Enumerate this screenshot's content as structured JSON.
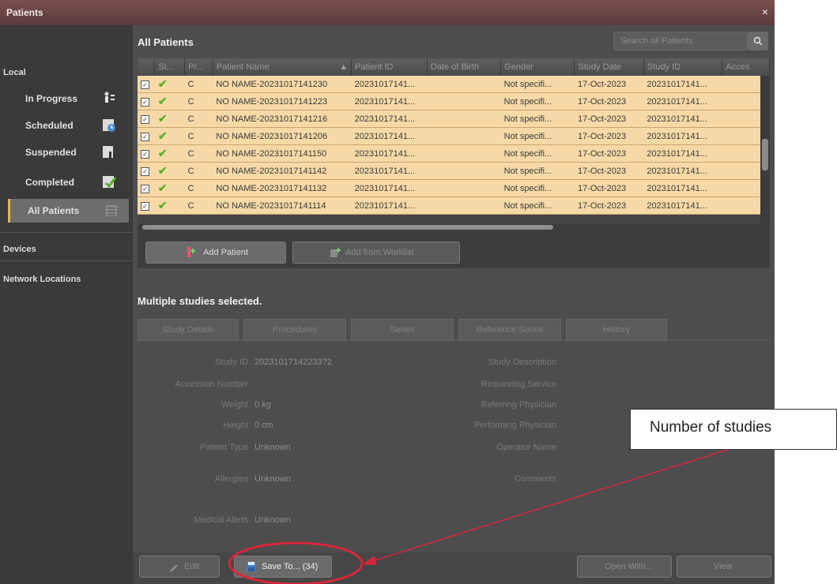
{
  "window": {
    "title": "Patients",
    "close_label": "×"
  },
  "sidebar": {
    "local_label": "Local",
    "items": [
      {
        "label": "In Progress",
        "icon": "in-progress-icon"
      },
      {
        "label": "Scheduled",
        "icon": "scheduled-icon"
      },
      {
        "label": "Suspended",
        "icon": "suspended-icon"
      },
      {
        "label": "Completed",
        "icon": "completed-icon"
      },
      {
        "label": "All Patients",
        "icon": "all-patients-icon",
        "active": true
      }
    ],
    "devices_label": "Devices",
    "network_label": "Network Locations"
  },
  "main": {
    "title": "All Patients",
    "search_placeholder": "Search all Patients",
    "search_icon": "search-icon"
  },
  "table": {
    "columns": [
      "St...",
      "Pr...",
      "Patient Name",
      "Patient ID",
      "Date of Birth",
      "Gender",
      "Study Date",
      "Study ID",
      "Acces"
    ],
    "sort_indicator": "▲",
    "rows": [
      {
        "status": "C",
        "name": "NO NAME-20231017141230",
        "pid": "20231017141...",
        "dob": "",
        "gender": "Not specifi...",
        "date": "17-Oct-2023",
        "sid": "20231017141..."
      },
      {
        "status": "C",
        "name": "NO NAME-20231017141223",
        "pid": "20231017141...",
        "dob": "",
        "gender": "Not specifi...",
        "date": "17-Oct-2023",
        "sid": "20231017141..."
      },
      {
        "status": "C",
        "name": "NO NAME-20231017141216",
        "pid": "20231017141...",
        "dob": "",
        "gender": "Not specifi...",
        "date": "17-Oct-2023",
        "sid": "20231017141..."
      },
      {
        "status": "C",
        "name": "NO NAME-20231017141206",
        "pid": "20231017141...",
        "dob": "",
        "gender": "Not specifi...",
        "date": "17-Oct-2023",
        "sid": "20231017141..."
      },
      {
        "status": "C",
        "name": "NO NAME-20231017141150",
        "pid": "20231017141...",
        "dob": "",
        "gender": "Not specifi...",
        "date": "17-Oct-2023",
        "sid": "20231017141..."
      },
      {
        "status": "C",
        "name": "NO NAME-20231017141142",
        "pid": "20231017141...",
        "dob": "",
        "gender": "Not specifi...",
        "date": "17-Oct-2023",
        "sid": "20231017141..."
      },
      {
        "status": "C",
        "name": "NO NAME-20231017141132",
        "pid": "20231017141...",
        "dob": "",
        "gender": "Not specifi...",
        "date": "17-Oct-2023",
        "sid": "20231017141..."
      },
      {
        "status": "C",
        "name": "NO NAME-20231017141114",
        "pid": "20231017141...",
        "dob": "",
        "gender": "Not specifi...",
        "date": "17-Oct-2023",
        "sid": "20231017141..."
      }
    ]
  },
  "buttons": {
    "add_patient": "Add Patient",
    "add_worklist": "Add from Worklist",
    "edit": "Edit",
    "save_to": "Save To... (34)",
    "open_with": "Open With...",
    "view": "View"
  },
  "selection": {
    "message": "Multiple studies selected."
  },
  "tabs": [
    "Study Details",
    "Procedures",
    "Series",
    "Reference Series",
    "History"
  ],
  "details_left": [
    {
      "label": "Study ID",
      "value": "20231017142233?2"
    },
    {
      "label": "Accession Number",
      "value": ""
    },
    {
      "label": "Weight",
      "value": "0 kg"
    },
    {
      "label": "Height",
      "value": "0 cm"
    },
    {
      "label": "Patient Type",
      "value": "Unknown"
    },
    {
      "label": "Allergies",
      "value": "Unknown"
    },
    {
      "label": "Medical Alerts",
      "value": "Unknown"
    }
  ],
  "details_right": [
    {
      "label": "Study Description"
    },
    {
      "label": "Requesting Service"
    },
    {
      "label": "Referring Physician"
    },
    {
      "label": "Performing Physician"
    },
    {
      "label": "Operator Name"
    },
    {
      "label": "Comments"
    }
  ],
  "annotation": {
    "text": "Number of studies",
    "color": "#d9263a"
  },
  "colors": {
    "row_highlight": "#f6d9a6",
    "accent": "#e4b550",
    "check": "#5cae2e"
  }
}
